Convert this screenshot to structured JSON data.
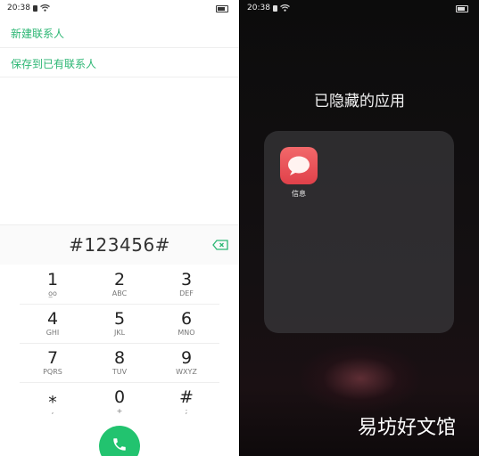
{
  "left_phone": {
    "status": {
      "time": "20:38"
    },
    "menu": [
      "新建联系人",
      "保存到已有联系人"
    ],
    "dialed_number": "#123456#",
    "keypad": [
      {
        "digit": "1",
        "letters": "ᴏ̲ᴏ"
      },
      {
        "digit": "2",
        "letters": "ABC"
      },
      {
        "digit": "3",
        "letters": "DEF"
      },
      {
        "digit": "4",
        "letters": "GHI"
      },
      {
        "digit": "5",
        "letters": "JKL"
      },
      {
        "digit": "6",
        "letters": "MNO"
      },
      {
        "digit": "7",
        "letters": "PQRS"
      },
      {
        "digit": "8",
        "letters": "TUV"
      },
      {
        "digit": "9",
        "letters": "WXYZ"
      },
      {
        "digit": "⁎",
        "letters": ","
      },
      {
        "digit": "0",
        "letters": "+"
      },
      {
        "digit": "#",
        "letters": ";"
      }
    ],
    "accent": "#2bb673"
  },
  "right_phone": {
    "status": {
      "time": "20:38"
    },
    "title": "已隐藏的应用",
    "apps": [
      {
        "label": "信息",
        "icon": "message-bubble-icon"
      }
    ]
  },
  "watermark": "易坊好文馆"
}
